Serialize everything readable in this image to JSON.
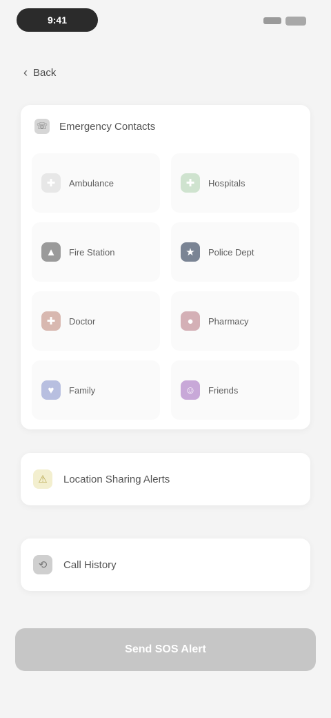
{
  "status": {
    "time": "9:41"
  },
  "nav": {
    "back_label": "Back"
  },
  "categories_card": {
    "title": "Emergency Contacts",
    "tiles": [
      {
        "label": "Ambulance",
        "icon": "ambulance-icon",
        "color": "#e7e7e7",
        "glyph": "✚"
      },
      {
        "label": "Hospitals",
        "icon": "hospital-icon",
        "color": "#cfe3cf",
        "glyph": "✚"
      },
      {
        "label": "Fire Station",
        "icon": "fire-icon",
        "color": "#9a9a9a",
        "glyph": "▲"
      },
      {
        "label": "Police Dept",
        "icon": "police-icon",
        "color": "#7a8494",
        "glyph": "★"
      },
      {
        "label": "Doctor",
        "icon": "doctor-icon",
        "color": "#d8b8b0",
        "glyph": "✚"
      },
      {
        "label": "Pharmacy",
        "icon": "pharmacy-icon",
        "color": "#d4b0b6",
        "glyph": "●"
      },
      {
        "label": "Family",
        "icon": "family-icon",
        "color": "#b8bfe0",
        "glyph": "♥"
      },
      {
        "label": "Friends",
        "icon": "friends-icon",
        "color": "#c8a8d8",
        "glyph": "☺"
      }
    ]
  },
  "alerts_card": {
    "label": "Location Sharing Alerts",
    "icon": "alert-icon",
    "color": "#f3efcf"
  },
  "history_card": {
    "label": "Call History",
    "icon": "history-icon",
    "color": "#cfcfcf"
  },
  "cta": {
    "label": "Send SOS Alert"
  }
}
